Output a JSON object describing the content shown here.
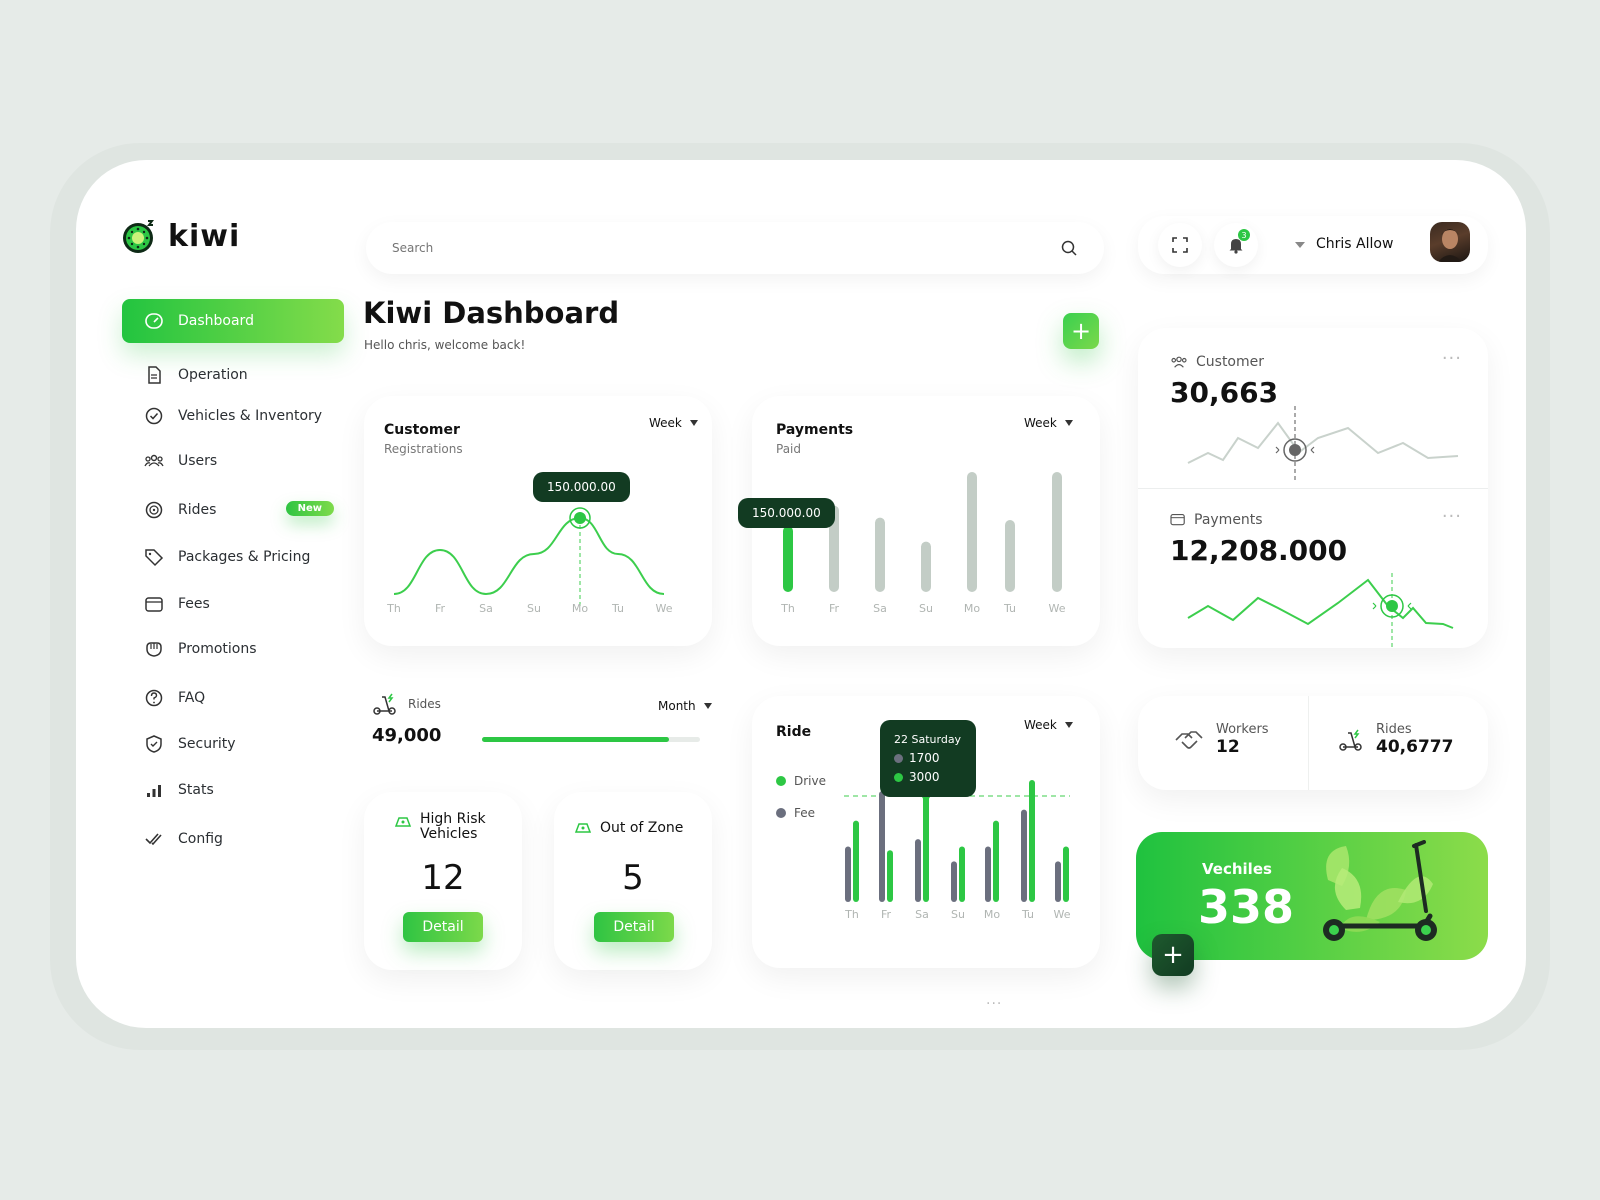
{
  "app": {
    "brand": "kiwi"
  },
  "sidebar": {
    "items": [
      {
        "label": "Dashboard",
        "icon": "speedometer-icon"
      },
      {
        "label": "Operation",
        "icon": "document-icon"
      },
      {
        "label": "Vehicles & Inventory",
        "icon": "check-circle-icon"
      },
      {
        "label": "Users",
        "icon": "users-icon"
      },
      {
        "label": "Rides",
        "icon": "target-icon",
        "badge": "New"
      },
      {
        "label": "Packages & Pricing",
        "icon": "tag-icon"
      },
      {
        "label": "Fees",
        "icon": "wallet-icon"
      },
      {
        "label": "Promotions",
        "icon": "glove-icon"
      },
      {
        "label": "FAQ",
        "icon": "question-icon"
      },
      {
        "label": "Security",
        "icon": "shield-icon"
      },
      {
        "label": "Stats",
        "icon": "bar-chart-icon"
      },
      {
        "label": "Config",
        "icon": "double-check-icon"
      }
    ]
  },
  "topbar": {
    "search_placeholder": "Search",
    "notification_count": "3",
    "user_name": "Chris Allow"
  },
  "header": {
    "title": "Kiwi Dashboard",
    "subtitle": "Hello chris, welcome back!"
  },
  "customer_card": {
    "title": "Customer",
    "subtitle": "Registrations",
    "period": "Week",
    "tooltip": "150.000.00"
  },
  "payments_card": {
    "title": "Payments",
    "subtitle": "Paid",
    "period": "Week",
    "tooltip": "150.000.00"
  },
  "rides_card": {
    "label": "Rides",
    "value": "49,000",
    "period": "Month",
    "progress": 0.86
  },
  "high_risk": {
    "title": "High Risk Vehicles",
    "value": "12",
    "button": "Detail"
  },
  "out_of_zone": {
    "title": "Out of Zone",
    "value": "5",
    "button": "Detail"
  },
  "ride_card": {
    "title": "Ride",
    "period": "Week",
    "legend": [
      "Drive",
      "Fee"
    ],
    "tooltip": {
      "day": "22 Saturday",
      "fee": "1700",
      "drive": "3000"
    }
  },
  "summary": {
    "customer": {
      "label": "Customer",
      "value": "30,663"
    },
    "payments": {
      "label": "Payments",
      "value": "12,208.000"
    }
  },
  "workers": {
    "label": "Workers",
    "value": "12"
  },
  "rides_stat": {
    "label": "Rides",
    "value": "40,6777"
  },
  "vehicles": {
    "label": "Vechiles",
    "value": "338"
  },
  "colors": {
    "accent": "#2dc744",
    "dark": "#123b22",
    "grey_bar": "#c3cdc6",
    "fee": "#6b6f7e"
  },
  "chart_data": [
    {
      "type": "line",
      "categories": [
        "Th",
        "Fr",
        "Sa",
        "Su",
        "Mo",
        "Tu",
        "We"
      ],
      "series": [
        {
          "values": [
            0.05,
            0.6,
            0.05,
            0.55,
            1.0,
            0.55,
            0.05
          ]
        }
      ],
      "highlight_index": 4
    },
    {
      "type": "bar",
      "categories": [
        "Th",
        "Fr",
        "Sa",
        "Su",
        "Mo",
        "Tu",
        "We"
      ],
      "series": [
        {
          "values": [
            0.55,
            0.72,
            0.62,
            0.42,
            1.0,
            0.6,
            1.0
          ]
        }
      ],
      "highlight_index": 0
    },
    {
      "type": "bar",
      "categories": [
        "Th",
        "Fr",
        "Sa",
        "Su",
        "Mo",
        "Tu",
        "We"
      ],
      "series": [
        {
          "name": "Drive",
          "values": [
            2200,
            1400,
            3000,
            1500,
            2200,
            3300,
            1500
          ]
        },
        {
          "name": "Fee",
          "values": [
            1500,
            3000,
            1700,
            1100,
            1500,
            2500,
            1100
          ]
        }
      ],
      "highlight_index": 2
    }
  ]
}
